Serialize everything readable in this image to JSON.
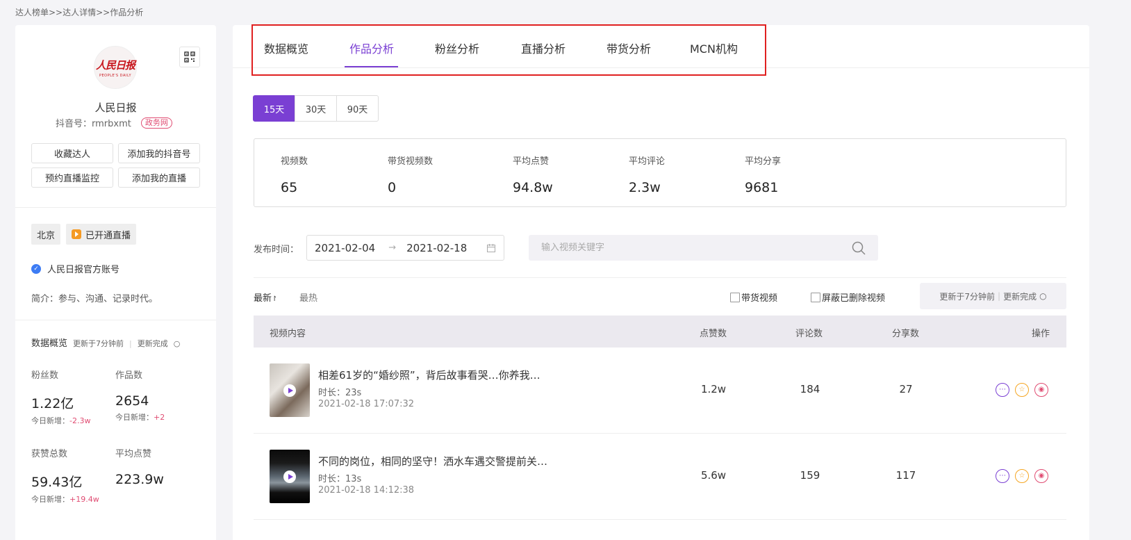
{
  "breadcrumb": "达人榜单>>达人详情>>作品分析",
  "profile": {
    "logo_text": "人民日报",
    "logo_sub": "PEOPLE'S DAILY",
    "name": "人民日报",
    "douyin_id": "抖音号：rmrbxmt",
    "gov_badge": "政务网",
    "buttons": [
      "收藏达人",
      "添加我的抖音号",
      "预约直播监控",
      "添加我的直播"
    ],
    "city_tag": "北京",
    "live_tag": "已开通直播",
    "verified": "人民日报官方账号",
    "intro": "简介：参与、沟通、记录时代。"
  },
  "overview": {
    "title": "数据概览",
    "updated": "更新于7分钟前",
    "status": "更新完成",
    "stats": [
      {
        "label": "粉丝数",
        "value": "1.22亿",
        "inc_label": "今日新增：",
        "inc": "-2.3w"
      },
      {
        "label": "作品数",
        "value": "2654",
        "inc_label": "今日新增：",
        "inc": "+2"
      },
      {
        "label": "获赞总数",
        "value": "59.43亿",
        "inc_label": "今日新增：",
        "inc": "+19.4w"
      },
      {
        "label": "平均点赞",
        "value": "223.9w",
        "inc_label": "",
        "inc": ""
      }
    ]
  },
  "tabs": [
    "数据概览",
    "作品分析",
    "粉丝分析",
    "直播分析",
    "带货分析",
    "MCN机构"
  ],
  "active_tab": "作品分析",
  "ranges": [
    "15天",
    "30天",
    "90天"
  ],
  "metrics": [
    {
      "label": "视频数",
      "value": "65"
    },
    {
      "label": "带货视频数",
      "value": "0"
    },
    {
      "label": "平均点赞",
      "value": "94.8w"
    },
    {
      "label": "平均评论",
      "value": "2.3w"
    },
    {
      "label": "平均分享",
      "value": "9681"
    }
  ],
  "filter": {
    "pub_label": "发布时间：",
    "date_start": "2021-02-04",
    "date_end": "2021-02-18",
    "search_placeholder": "输入视频关键字"
  },
  "sort": {
    "newest": "最新",
    "hottest": "最热"
  },
  "checks": [
    "带货视频",
    "屏蔽已删除视频"
  ],
  "update_pill": {
    "updated": "更新于7分钟前",
    "status": "更新完成"
  },
  "table": {
    "headers": [
      "视频内容",
      "点赞数",
      "评论数",
      "分享数",
      "操作"
    ],
    "rows": [
      {
        "title": "相差61岁的“婚纱照”，背后故事看哭…你养我…",
        "duration": "时长：23s",
        "date": "2021-02-18 17:07:32",
        "likes": "1.2w",
        "comments": "184",
        "shares": "27"
      },
      {
        "title": "不同的岗位，相同的坚守！洒水车遇交警提前关…",
        "duration": "时长：13s",
        "date": "2021-02-18 14:12:38",
        "likes": "5.6w",
        "comments": "159",
        "shares": "117"
      }
    ]
  },
  "colors": {
    "accent": "#7a3fd3",
    "highlight_box": "#e02020",
    "negative": "#e04c72"
  }
}
